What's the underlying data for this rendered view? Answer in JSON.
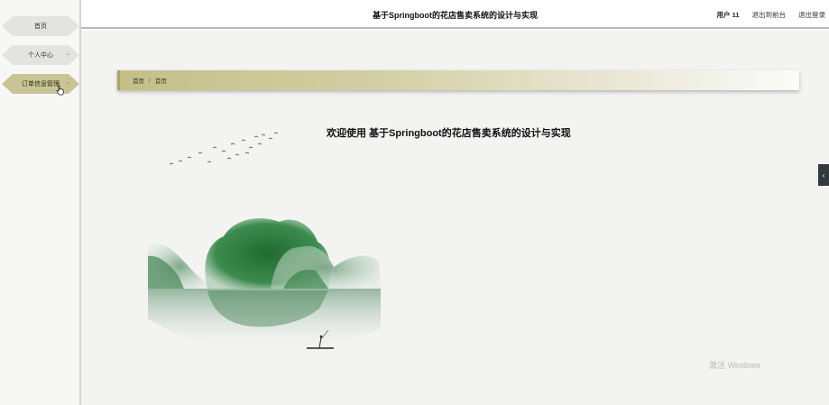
{
  "header": {
    "title": "基于Springboot的花店售卖系统的设计与实现",
    "user_label": "用户 11",
    "to_front_label": "退出到前台",
    "logout_label": "退出登录"
  },
  "sidebar": {
    "items": [
      {
        "label": "首页",
        "has_chevron": false
      },
      {
        "label": "个人中心",
        "has_chevron": true
      },
      {
        "label": "订单信息管理",
        "has_chevron": true
      }
    ],
    "active_index": 2,
    "chevron_glyph": "⌄"
  },
  "breadcrumb": {
    "items": [
      "首页",
      "首页"
    ],
    "separator": "/"
  },
  "main": {
    "welcome_text": "欢迎使用 基于Springboot的花店售卖系统的设计与实现"
  },
  "side_tab": {
    "glyph": "‹"
  },
  "watermark": "激活 Windows",
  "colors": {
    "accent": "#c9c495",
    "sidebar_bg": "#f7f7f6",
    "main_bg": "#f3f3f2",
    "ink_green": "#2f7d3e"
  }
}
